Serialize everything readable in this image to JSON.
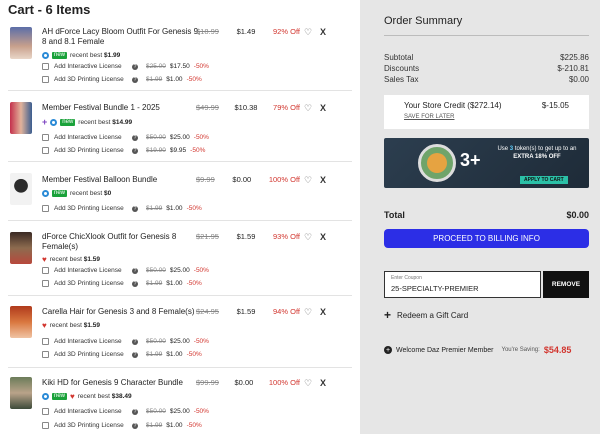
{
  "cart": {
    "title": "Cart - 6 Items"
  },
  "items": [
    {
      "name": "AH dForce Lacy Bloom Outfit For Genesis 9, 8 and 8.1 Female",
      "orig": "$18.99",
      "price": "$1.49",
      "off": "92% Off",
      "badge_new": "new",
      "recent_label": "recent best",
      "recent_value": "$1.99",
      "licenses": [
        {
          "label": "Add Interactive License",
          "orig": "$25.00",
          "price": "$17.50",
          "pct": "-50%"
        },
        {
          "label": "Add 3D Printing License",
          "orig": "$1.99",
          "price": "$1.00",
          "pct": "-50%"
        }
      ]
    },
    {
      "name": "Member Festival Bundle 1 - 2025",
      "orig": "$49.99",
      "price": "$10.38",
      "off": "79% Off",
      "badge_new": "new",
      "recent_label": "recent best",
      "recent_value": "$14.99",
      "licenses": [
        {
          "label": "Add Interactive License",
          "orig": "$50.00",
          "price": "$25.00",
          "pct": "-50%"
        },
        {
          "label": "Add 3D Printing License",
          "orig": "$19.90",
          "price": "$9.95",
          "pct": "-50%"
        }
      ]
    },
    {
      "name": "Member Festival Balloon Bundle",
      "orig": "$9.99",
      "price": "$0.00",
      "off": "100% Off",
      "badge_new": "new",
      "recent_label": "recent best",
      "recent_value": "$0",
      "licenses": [
        {
          "label": "Add 3D Printing License",
          "orig": "$1.99",
          "price": "$1.00",
          "pct": "-50%"
        }
      ]
    },
    {
      "name": "dForce ChicXlook Outfit for Genesis 8 Female(s)",
      "orig": "$21.95",
      "price": "$1.59",
      "off": "93% Off",
      "recent_label": "recent best",
      "recent_value": "$1.59",
      "licenses": [
        {
          "label": "Add Interactive License",
          "orig": "$50.00",
          "price": "$25.00",
          "pct": "-50%"
        },
        {
          "label": "Add 3D Printing License",
          "orig": "$1.99",
          "price": "$1.00",
          "pct": "-50%"
        }
      ]
    },
    {
      "name": "Carella Hair for Genesis 3 and 8 Female(s)",
      "orig": "$24.95",
      "price": "$1.59",
      "off": "94% Off",
      "recent_label": "recent best",
      "recent_value": "$1.59",
      "licenses": [
        {
          "label": "Add Interactive License",
          "orig": "$50.00",
          "price": "$25.00",
          "pct": "-50%"
        },
        {
          "label": "Add 3D Printing License",
          "orig": "$1.99",
          "price": "$1.00",
          "pct": "-50%"
        }
      ]
    },
    {
      "name": "Kiki HD for Genesis 9 Character Bundle",
      "orig": "$99.99",
      "price": "$0.00",
      "off": "100% Off",
      "badge_new": "new",
      "recent_label": "recent best",
      "recent_value": "$38.49",
      "licenses": [
        {
          "label": "Add Interactive License",
          "orig": "$50.00",
          "price": "$25.00",
          "pct": "-50%"
        },
        {
          "label": "Add 3D Printing License",
          "orig": "$1.99",
          "price": "$1.00",
          "pct": "-50%"
        }
      ]
    }
  ],
  "summary": {
    "title": "Order Summary",
    "subtotal_label": "Subtotal",
    "subtotal": "$225.86",
    "discounts_label": "Discounts",
    "discounts": "$-210.81",
    "tax_label": "Sales Tax",
    "tax": "$0.00",
    "credit_label": "Your Store Credit ($272.14)",
    "credit_amount": "$-15.05",
    "save_later": "SAVE FOR LATER",
    "promo_big": "3+",
    "promo_line1": "Use",
    "promo_tokens": "3",
    "promo_line2": "token(s) to get up to an",
    "promo_line3": "EXTRA 18% OFF",
    "promo_button": "APPLY TO CART",
    "total_label": "Total",
    "total": "$0.00",
    "checkout_button": "PROCEED TO BILLING INFO",
    "coupon_label": "Enter Coupon",
    "coupon_value": "25-SPECIALTY-PREMIER",
    "remove_button": "REMOVE",
    "redeem_label": "Redeem a Gift Card",
    "welcome_label": "Welcome Daz Premier Member",
    "saving_label": "You're Saving:",
    "saving_amount": "$54.85"
  },
  "colors": {
    "accent": "#2c2ee6",
    "sale_red": "#d2362f",
    "new_green": "#1aa23a"
  },
  "icons": {
    "heart": "heart-icon",
    "remove": "x-icon",
    "eye": "eye-icon",
    "help": "question-icon",
    "plus": "plus-icon",
    "premier": "daz-premier-icon"
  }
}
